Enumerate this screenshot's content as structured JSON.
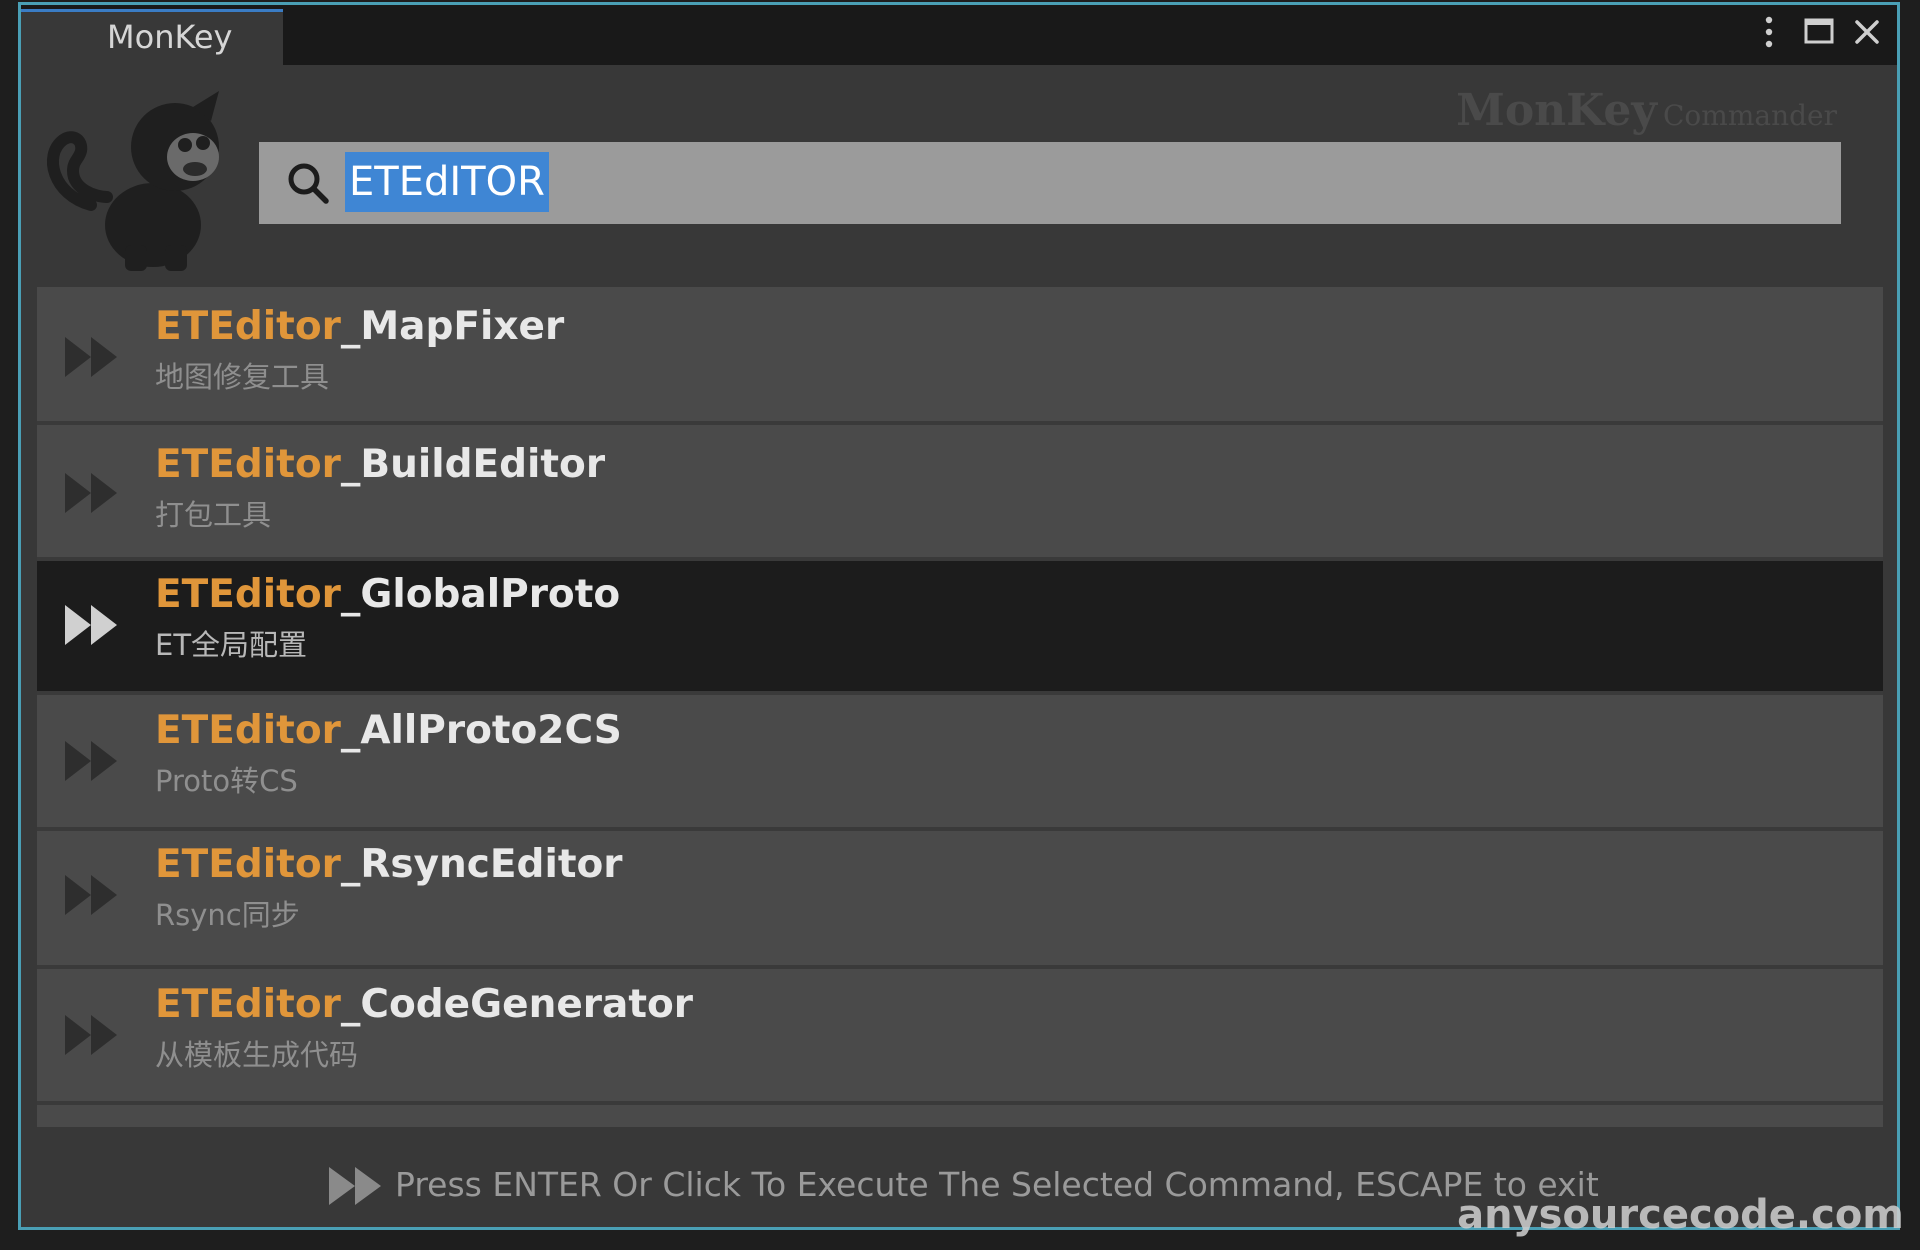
{
  "window": {
    "tab_title": "MonKey",
    "menu_icon": "kebab-menu-icon",
    "maximize_icon": "maximize-icon",
    "close_icon": "close-icon"
  },
  "header": {
    "brand_name": "MonKey",
    "brand_suffix": "Commander",
    "logo_icon": "monkey-logo"
  },
  "search": {
    "icon": "search-icon",
    "query": "ETEdITOR"
  },
  "results": [
    {
      "prefix": "ETEditor",
      "suffix": "_MapFixer",
      "subtitle": "地图修复工具",
      "selected": false
    },
    {
      "prefix": "ETEditor",
      "suffix": "_BuildEditor",
      "subtitle": "打包工具",
      "selected": false
    },
    {
      "prefix": "ETEditor",
      "suffix": "_GlobalProto",
      "subtitle": "ET全局配置",
      "selected": true
    },
    {
      "prefix": "ETEditor",
      "suffix": "_AllProto2CS",
      "subtitle": "Proto转CS",
      "selected": false
    },
    {
      "prefix": "ETEditor",
      "suffix": "_RsyncEditor",
      "subtitle": "Rsync同步",
      "selected": false
    },
    {
      "prefix": "ETEditor",
      "suffix": "_CodeGenerator",
      "subtitle": "从模板生成代码",
      "selected": false
    }
  ],
  "footer": {
    "icon": "fast-forward-icon",
    "hint": "Press ENTER Or Click To Execute The Selected Command, ESCAPE to exit"
  },
  "watermark": "anysourcecode.com",
  "colors": {
    "highlight": "#e0963a",
    "selection": "#3f86d4",
    "window_border": "#4a9fb5",
    "selected_row": "#1c1c1c"
  }
}
